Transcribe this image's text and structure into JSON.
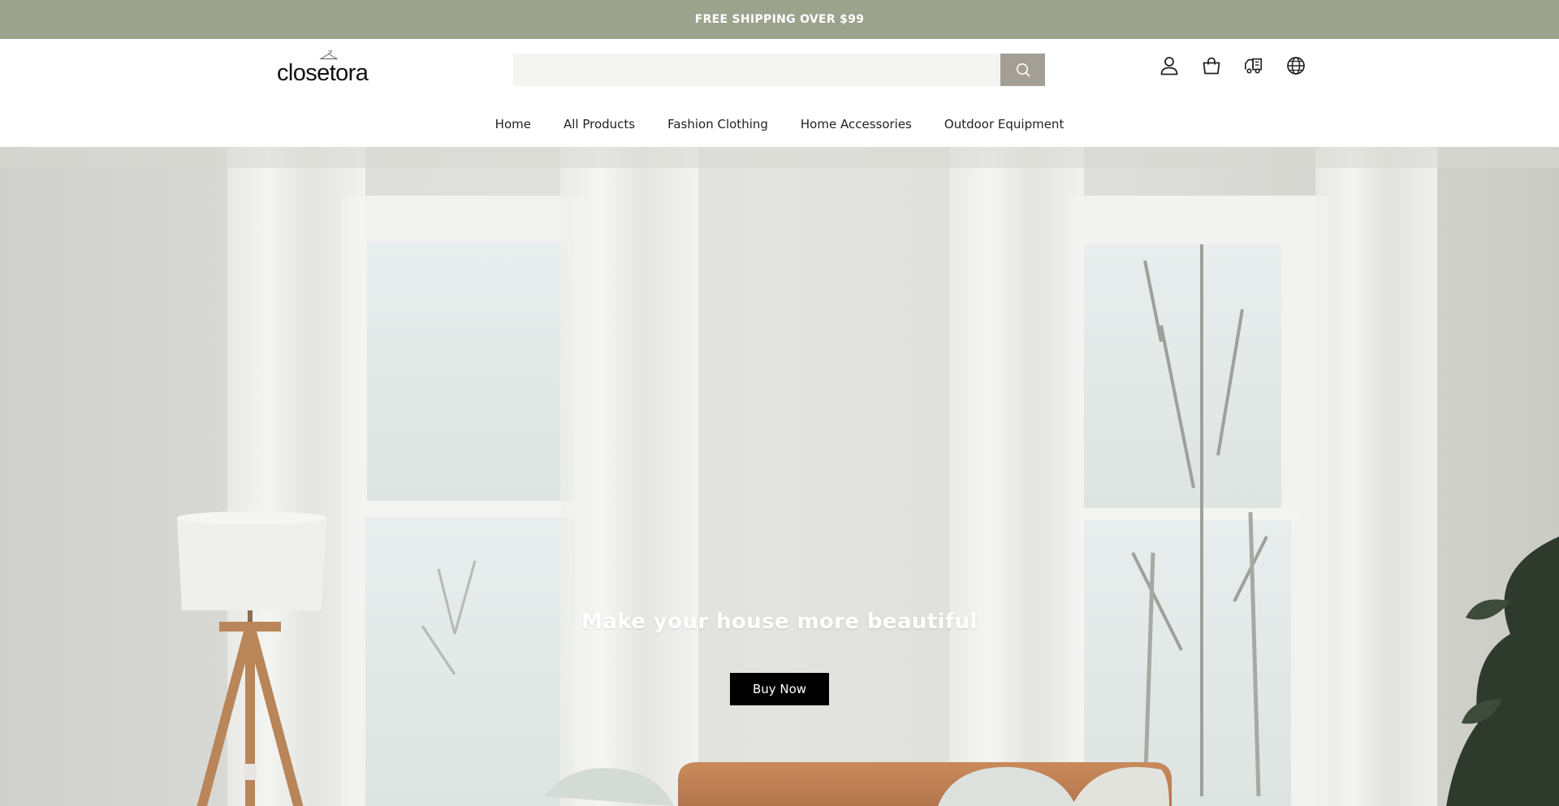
{
  "announcement": {
    "text": "FREE SHIPPING OVER $99"
  },
  "header": {
    "logo_text": "closetora",
    "search": {
      "placeholder": "",
      "value": ""
    },
    "icons": [
      "account-icon",
      "cart-icon",
      "order-tracking-icon",
      "language-globe-icon"
    ]
  },
  "nav": {
    "items": [
      {
        "label": "Home"
      },
      {
        "label": "All Products"
      },
      {
        "label": "Fashion Clothing"
      },
      {
        "label": "Home Accessories"
      },
      {
        "label": "Outdoor Equipment"
      }
    ]
  },
  "hero": {
    "title": "Make your house more beautiful",
    "button_label": "Buy Now"
  },
  "colors": {
    "announcement_bg": "#9ca38d",
    "search_button_bg": "#a39f94",
    "hero_button_bg": "#000000"
  }
}
